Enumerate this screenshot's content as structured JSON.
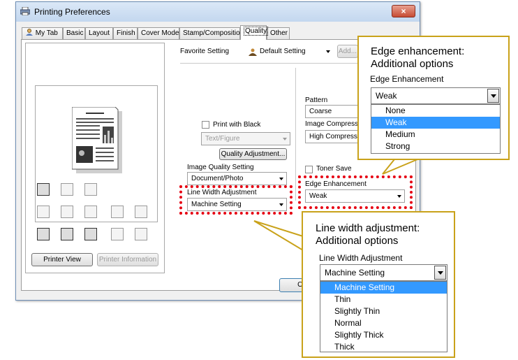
{
  "window": {
    "title": "Printing Preferences",
    "close_glyph": "×"
  },
  "tabs": [
    "My Tab",
    "Basic",
    "Layout",
    "Finish",
    "Cover Mode",
    "Stamp/Composition",
    "Quality",
    "Other"
  ],
  "left_panel": {
    "printer_view_label": "Printer View",
    "printer_information_label": "Printer Information"
  },
  "favorite": {
    "label": "Favorite Setting",
    "value": "Default Setting",
    "add_label": "Add..."
  },
  "quality": {
    "print_with_black_label": "Print with Black",
    "text_figure_value": "Text/Figure",
    "quality_adjustment_label": "Quality Adjustment...",
    "image_quality_label": "Image Quality Setting",
    "image_quality_value": "Document/Photo",
    "line_width_label": "Line Width Adjustment",
    "line_width_value": "Machine Setting",
    "pattern_label": "Pattern",
    "pattern_value": "Coarse",
    "image_compression_label": "Image Compression",
    "image_compression_value": "High Compression",
    "toner_save_label": "Toner Save",
    "edge_label": "Edge Enhancement",
    "edge_value": "Weak",
    "ok_label": "O"
  },
  "callout_edge": {
    "title_line1": "Edge enhancement:",
    "title_line2": "Additional options",
    "combo_label": "Edge Enhancement",
    "selected": "Weak",
    "options": [
      "None",
      "Weak",
      "Medium",
      "Strong"
    ],
    "selected_index": 1
  },
  "callout_line": {
    "title_line1": "Line width adjustment:",
    "title_line2": "Additional options",
    "combo_label": "Line Width Adjustment",
    "selected": "Machine Setting",
    "options": [
      "Machine Setting",
      "Thin",
      "Slightly Thin",
      "Normal",
      "Slightly Thick",
      "Thick"
    ],
    "selected_index": 0
  },
  "colors": {
    "highlight_red": "#e60012",
    "callout_border": "#c9a21a",
    "selection_blue": "#3399ff"
  }
}
